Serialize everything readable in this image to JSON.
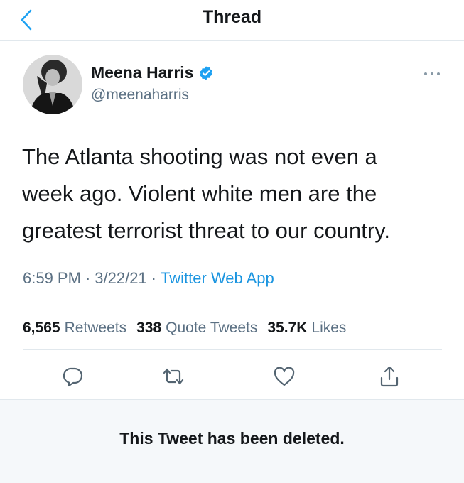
{
  "header": {
    "title": "Thread",
    "back_icon": "chevron-left-icon"
  },
  "tweet": {
    "author": {
      "display_name": "Meena Harris",
      "handle": "@meenaharris",
      "verified": true
    },
    "text": "The Atlanta shooting was not even a\nweek ago. Violent white men are the\ngreatest terrorist threat to our country.",
    "time": "6:59 PM",
    "date": "3/22/21",
    "separator": "·",
    "source": "Twitter Web App",
    "stats": [
      {
        "count": "6,565",
        "label": "Retweets"
      },
      {
        "count": "338",
        "label": "Quote Tweets"
      },
      {
        "count": "35.7K",
        "label": "Likes"
      }
    ],
    "actions": [
      "reply-icon",
      "retweet-icon",
      "like-icon",
      "share-icon"
    ]
  },
  "deleted_notice": "This Tweet has been deleted.",
  "colors": {
    "accent": "#1b95e0",
    "secondary_text": "#5b7083",
    "primary_text": "#14171a",
    "divider": "#e1e8ed",
    "deleted_bg": "#f5f8fa"
  }
}
